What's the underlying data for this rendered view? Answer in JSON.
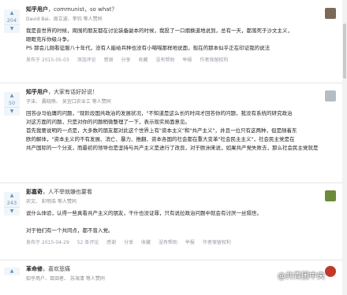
{
  "answers": [
    {
      "votes": "204",
      "author": "知乎用户",
      "tag": "，communist，so what？",
      "voters": "David Bai、周立波、李钧 等人赞同",
      "text": [
        "我是普世界的时候，周围的朋友都在讨论装备副本的时候，我投了一口烟换道地说到，总有一天，都落死于沙文主义，",
        "眼眶充斥你级斗争。",
        "PS 那会儿刚看征服八十年代，没有人能给兵种也没有小喵喵那样地说面，现在的那本似乎正在印证我的说法"
      ],
      "date": "发布于 2015-05-03",
      "actions": [
        "添加评论",
        "感谢",
        "分享",
        "收藏",
        "没有帮助",
        "举报",
        "作者保留权利"
      ],
      "avatar_color": "#7b6a5a"
    },
    {
      "votes": "50",
      "author": "知乎用户",
      "tag": "，大家有话好好说！",
      "voters": "子沫、 晨晓熊、 吴宜口农业工 等人赞同",
      "text": [
        "回答@马伯庸的问题，\"现阶段国共政治的发展状况，\"不知道是这么长的时间才回答你的问题，我没有系统的研究政治",
        "对这方面的问题，只是对你的问题稍微整理了一下，表示现实局面意见。",
        "首先我要说明的一点是，大多数的朋友都对此这个世界上有\"资本主义\"和\"共产主义\"，并且一位只有这两种，但是随着东",
        "欧的解体，\"资本主义的不有发展、消亡、暴力、推翻、资本各国的社会都在重大变革\"社会民主主义\"，社会民主党是在",
        "共产国际的一个分支，而最初的领导也是坚持与共产主义是进行了改良，对于欧洲来说，如果共产党失败去，那么社会民主党就是"
      ],
      "date": "",
      "actions": [],
      "avatar_color": "#b4bcc4"
    },
    {
      "votes": "243",
      "author": "彭嘉奇",
      "tag": "，人不举就嫌也要看",
      "voters": "农文、 彩明浩 等人赞同",
      "text": [
        "说什么体验，认得一些真看共产主义的朋友，干什也没证罪，只有说拉政治问题中就会有讨厌一丝隔世。",
        "",
        "对于他们有一个共同点，都不曾入党。"
      ],
      "date": "发布于 2015-04-29",
      "actions": [
        "52 条评论",
        "感谢",
        "分享",
        "收藏",
        "没有帮助",
        "举报",
        "作者保留权利"
      ],
      "avatar_color": "#6c8a3c"
    },
    {
      "votes": "",
      "author": "革命修",
      "tag": "，喜欢悲痛",
      "voters": "知乎用户、目田者、 苏海清 等人赞同",
      "text": [],
      "date": "",
      "actions": [],
      "avatar_color": "#c0392b"
    }
  ],
  "watermark": "@共青团中央"
}
